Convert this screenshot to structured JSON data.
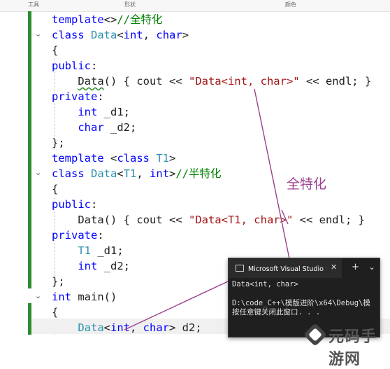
{
  "toolbar": {
    "items": [
      "工具",
      "形状",
      "颜色"
    ]
  },
  "code": {
    "lines": [
      {
        "parts": [
          [
            "kw",
            "template"
          ],
          [
            "",
            "<>"
          ],
          [
            "cm",
            "//全特化"
          ]
        ]
      },
      {
        "parts": [
          [
            "kw",
            "class"
          ],
          [
            "",
            " "
          ],
          [
            "ty",
            "Data"
          ],
          [
            "",
            "<"
          ],
          [
            "kw",
            "int"
          ],
          [
            "",
            ", "
          ],
          [
            "kw",
            "char"
          ],
          [
            "",
            ">"
          ]
        ]
      },
      {
        "parts": [
          [
            "",
            "{"
          ]
        ]
      },
      {
        "parts": [
          [
            "kw",
            "public"
          ],
          [
            "",
            ":"
          ]
        ]
      },
      {
        "parts": [
          [
            "",
            "    "
          ],
          [
            "sq",
            "Data"
          ],
          [
            "",
            "() { cout << "
          ],
          [
            "str",
            "\"Data<int, char>\""
          ],
          [
            "",
            " << endl; }"
          ]
        ]
      },
      {
        "parts": [
          [
            "kw",
            "private"
          ],
          [
            "",
            ":"
          ]
        ]
      },
      {
        "parts": [
          [
            "",
            "    "
          ],
          [
            "kw",
            "int"
          ],
          [
            "",
            " _d1;"
          ]
        ]
      },
      {
        "parts": [
          [
            "",
            "    "
          ],
          [
            "kw",
            "char"
          ],
          [
            "",
            " _d2;"
          ]
        ]
      },
      {
        "parts": [
          [
            "",
            "};"
          ]
        ]
      },
      {
        "parts": [
          [
            "kw",
            "template"
          ],
          [
            "",
            " <"
          ],
          [
            "kw",
            "class"
          ],
          [
            "",
            " "
          ],
          [
            "ty",
            "T1"
          ],
          [
            "",
            ">"
          ]
        ]
      },
      {
        "parts": [
          [
            "kw",
            "class"
          ],
          [
            "",
            " "
          ],
          [
            "ty",
            "Data"
          ],
          [
            "",
            "<"
          ],
          [
            "ty",
            "T1"
          ],
          [
            "",
            ", "
          ],
          [
            "kw",
            "int"
          ],
          [
            "",
            ">"
          ],
          [
            "cm",
            "//半特化"
          ]
        ]
      },
      {
        "parts": [
          [
            "",
            "{"
          ]
        ]
      },
      {
        "parts": [
          [
            "kw",
            "public"
          ],
          [
            "",
            ":"
          ]
        ]
      },
      {
        "parts": [
          [
            "",
            "    "
          ],
          [
            "",
            "Data"
          ],
          [
            "",
            "() { cout << "
          ],
          [
            "str",
            "\"Data<T1, char>\""
          ],
          [
            "",
            " << endl; }"
          ]
        ]
      },
      {
        "parts": [
          [
            "kw",
            "private"
          ],
          [
            "",
            ":"
          ]
        ]
      },
      {
        "parts": [
          [
            "",
            "    "
          ],
          [
            "ty",
            "T1"
          ],
          [
            "",
            " _d1;"
          ]
        ]
      },
      {
        "parts": [
          [
            "",
            "    "
          ],
          [
            "kw",
            "int"
          ],
          [
            "",
            " _d2;"
          ]
        ]
      },
      {
        "parts": [
          [
            "",
            "};"
          ]
        ]
      },
      {
        "parts": [
          [
            "kw",
            "int"
          ],
          [
            "",
            " main()"
          ]
        ]
      },
      {
        "parts": [
          [
            "",
            "{"
          ]
        ]
      },
      {
        "parts": [
          [
            "",
            "    "
          ],
          [
            "ty",
            "Data"
          ],
          [
            "",
            "<"
          ],
          [
            "kw",
            "int"
          ],
          [
            "",
            ", "
          ],
          [
            "kw",
            "char"
          ],
          [
            "",
            "> d2;"
          ]
        ]
      }
    ]
  },
  "annotation": {
    "label": "全特化"
  },
  "console": {
    "title": "Microsoft Visual Studio 调试控制台",
    "close": "✕",
    "plus": "+",
    "chevron": "⌄",
    "lines": [
      "Data<int, char>",
      "",
      "D:\\code_C++\\模版进阶\\x64\\Debug\\模",
      "按任意键关闭此窗口. . ."
    ]
  },
  "watermark": {
    "text": "元码手游网"
  },
  "colors": {
    "keyword": "#0000ff",
    "type": "#2b91af",
    "string": "#a31515",
    "comment": "#008000",
    "annotation": "#9b3f8e"
  }
}
